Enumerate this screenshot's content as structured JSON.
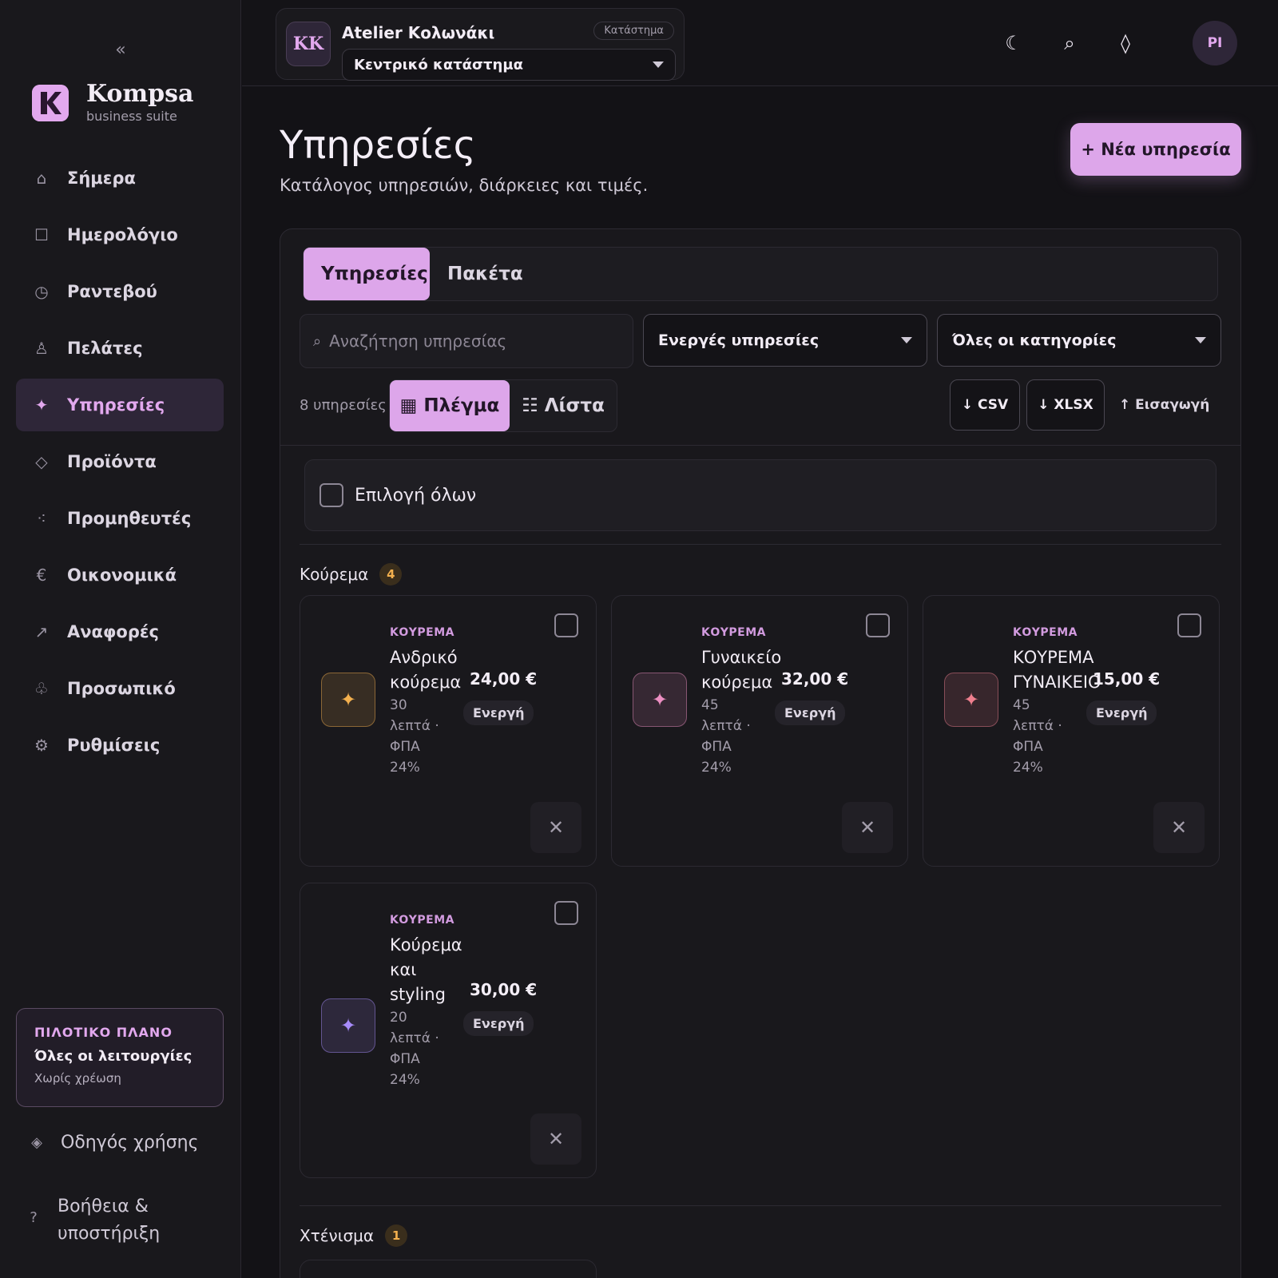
{
  "sidebar": {
    "collapse_icon": "«",
    "brand": {
      "name": "Kompsa",
      "subtitle": "business suite"
    },
    "items": [
      {
        "label": "Σήμερα",
        "icon": "home-icon",
        "glyph": "⌂"
      },
      {
        "label": "Ημερολόγιο",
        "icon": "calendar-icon",
        "glyph": "☐"
      },
      {
        "label": "Ραντεβού",
        "icon": "clock-icon",
        "glyph": "◷"
      },
      {
        "label": "Πελάτες",
        "icon": "user-icon",
        "glyph": "♙"
      },
      {
        "label": "Υπηρεσίες",
        "icon": "sparkle-icon",
        "glyph": "✦",
        "active": true
      },
      {
        "label": "Προϊόντα",
        "icon": "diamond-icon",
        "glyph": "◇"
      },
      {
        "label": "Προμηθευτές",
        "icon": "dots-icon",
        "glyph": "⁖"
      },
      {
        "label": "Οικονομικά",
        "icon": "euro-icon",
        "glyph": "€"
      },
      {
        "label": "Αναφορές",
        "icon": "arrow-up-right-icon",
        "glyph": "↗"
      },
      {
        "label": "Προσωπικό",
        "icon": "staff-icon",
        "glyph": "♧"
      },
      {
        "label": "Ρυθμίσεις",
        "icon": "gear-icon",
        "glyph": "⚙"
      }
    ],
    "plan": {
      "eyebrow": "ΠΙΛΟΤΙΚΟ ΠΛΑΝΟ",
      "title": "Όλες οι λειτουργίες",
      "subtitle": "Χωρίς χρέωση"
    },
    "guide_label": "Οδηγός χρήσης",
    "help_label_1": "Βοήθεια &",
    "help_label_2": "υποστήριξη"
  },
  "header": {
    "store_initials": "KK",
    "store_name": "Atelier Κολωνάκι",
    "store_badge": "Κατάστημα",
    "branch": "Κεντρικό κατάστημα",
    "user_initials": "PI"
  },
  "page": {
    "title": "Υπηρεσίες",
    "subtitle": "Κατάλογος υπηρεσιών, διάρκειες και τιμές.",
    "new_button": "+ Νέα υπηρεσία"
  },
  "tabs": {
    "services": "Υπηρεσίες",
    "packages": "Πακέτα"
  },
  "filters": {
    "search_placeholder": "Αναζήτηση υπηρεσίας",
    "status": "Ενεργές υπηρεσίες",
    "category": "Όλες οι κατηγορίες"
  },
  "toolbar": {
    "count": "8 υπηρεσίες",
    "grid": "▦ Πλέγμα",
    "list": "☷ Λίστα",
    "csv": "↓ CSV",
    "xlsx": "↓ XLSX",
    "import": "↑ Εισαγωγή"
  },
  "select_all": "Επιλογή όλων",
  "groups": [
    {
      "name": "Κούρεμα",
      "count": "4",
      "services": [
        {
          "category": "ΚΟΥΡΕΜΑ",
          "name_lines": [
            "Ανδρικό",
            "κούρεμα"
          ],
          "price": "24,00 €",
          "meta_lines": [
            "30",
            "λεπτά ·",
            "ΦΠΑ",
            "24%"
          ],
          "status": "Ενεργή",
          "color": "#F3B04E"
        },
        {
          "category": "ΚΟΥΡΕΜΑ",
          "name_lines": [
            "Γυναικείο",
            "κούρεμα"
          ],
          "price": "32,00 €",
          "meta_lines": [
            "45",
            "λεπτά ·",
            "ΦΠΑ",
            "24%"
          ],
          "status": "Ενεργή",
          "color": "#EC8FC2"
        },
        {
          "category": "ΚΟΥΡΕΜΑ",
          "name_lines": [
            "ΚΟΥΡΕΜΑ",
            "ΓΥΝΑΙΚΕΙΟ"
          ],
          "price": "15,00 €",
          "meta_lines": [
            "45",
            "λεπτά ·",
            "ΦΠΑ",
            "24%"
          ],
          "status": "Ενεργή",
          "color": "#EE7F8E"
        },
        {
          "category": "ΚΟΥΡΕΜΑ",
          "name_lines": [
            "Κούρεμα",
            "και",
            "styling"
          ],
          "price": "30,00 €",
          "meta_lines": [
            "20",
            "λεπτά ·",
            "ΦΠΑ",
            "24%"
          ],
          "status": "Ενεργή",
          "color": "#A78BFA"
        }
      ]
    },
    {
      "name": "Χτένισμα",
      "count": "1"
    }
  ],
  "colors": {
    "accent": "#DDA6EA",
    "background": "#131216",
    "surface": "#19181C",
    "badge": "#F3B04E"
  }
}
